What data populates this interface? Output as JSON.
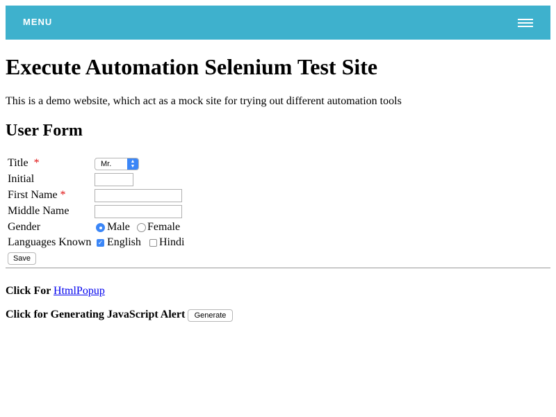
{
  "nav": {
    "menu_label": "MENU",
    "menu_icon": "hamburger-icon"
  },
  "page": {
    "title": "Execute Automation Selenium Test Site",
    "description": "This is a demo website, which act as a mock site for trying out different automation tools"
  },
  "form": {
    "heading": "User Form",
    "title_label": "Title",
    "title_value": "Mr.",
    "required_mark": "*",
    "initial_label": "Initial",
    "initial_value": "",
    "first_name_label": "First Name",
    "first_name_value": "",
    "middle_name_label": "Middle Name",
    "middle_name_value": "",
    "gender_label": "Gender",
    "gender_options": [
      {
        "label": "Male",
        "checked": true
      },
      {
        "label": "Female",
        "checked": false
      }
    ],
    "languages_label": "Languages Known",
    "language_options": [
      {
        "label": "English",
        "checked": true
      },
      {
        "label": "Hindi",
        "checked": false
      }
    ],
    "save_label": "Save"
  },
  "popup": {
    "prefix": "Click For",
    "link_text": "HtmlPopup"
  },
  "alert": {
    "prefix": "Click for Generating JavaScript Alert",
    "button_label": "Generate"
  },
  "colors": {
    "menu_bar": "#3eb1cd",
    "required": "#e01010",
    "accent": "#3b86f7",
    "link": "#0000ee"
  }
}
